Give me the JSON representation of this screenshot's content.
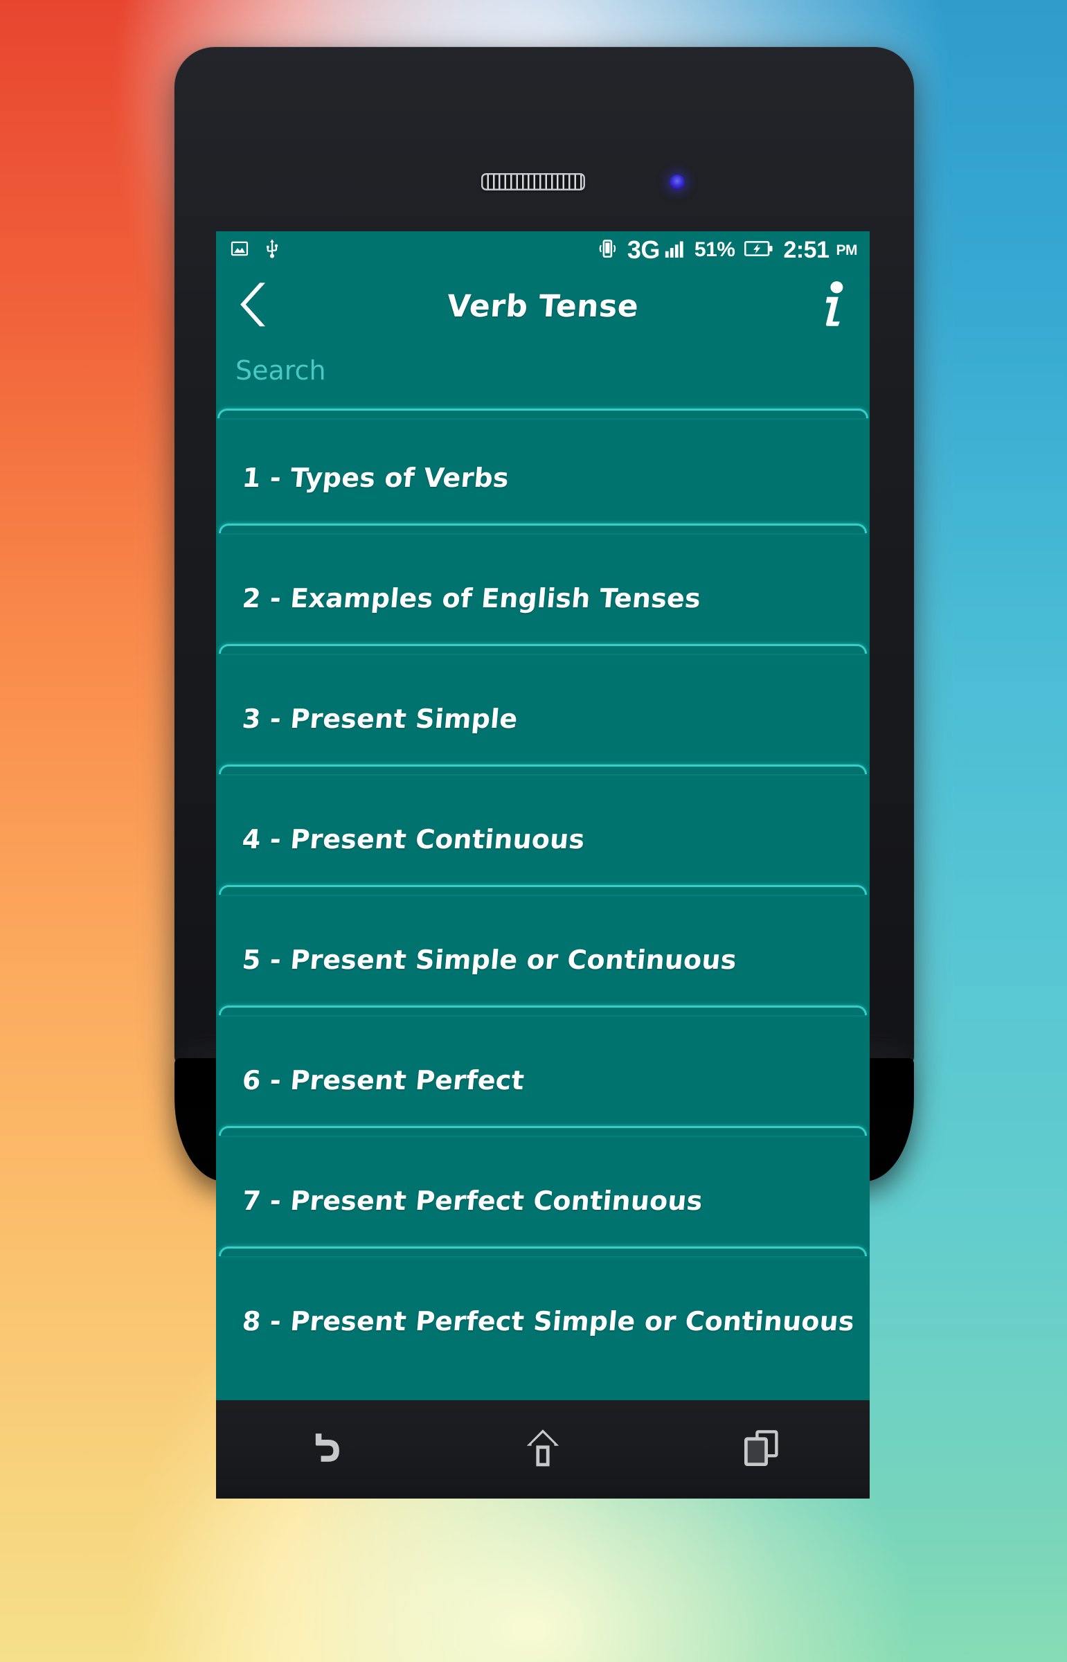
{
  "wallpaper": {
    "left_color": "#f0613a",
    "right_color": "#49bcd5",
    "top_glow": "#f0f0fa",
    "bottom_glow": "#fffacd"
  },
  "device": {
    "body_color": "#1b1d21",
    "speaker_name": "earpiece-speaker",
    "camera_name": "front-camera"
  },
  "statusbar": {
    "screenshot_icon": "image-icon",
    "usb_icon": "usb-icon",
    "vibrate_icon": "vibrate-icon",
    "network": "3G",
    "signal_icon": "signal-bars-icon",
    "battery_percent": "51%",
    "battery_icon": "battery-charging-icon",
    "time": "2:51",
    "ampm": "PM"
  },
  "appbar": {
    "back_icon": "back-chevron-icon",
    "title": "Verb Tense",
    "info_icon": "info-icon",
    "background": "#00736f"
  },
  "search": {
    "value": "",
    "placeholder": "Search",
    "placeholder_color": "#49c9c2",
    "underline_color": "#35cfc7"
  },
  "list": {
    "divider_color": "#35cfc7",
    "items": [
      {
        "label": "1 - Types of Verbs"
      },
      {
        "label": "2 - Examples of English Tenses"
      },
      {
        "label": "3 - Present Simple"
      },
      {
        "label": "4 - Present Continuous"
      },
      {
        "label": "5 - Present Simple or Continuous"
      },
      {
        "label": "6 - Present Perfect"
      },
      {
        "label": "7 - Present Perfect Continuous"
      },
      {
        "label": "8 - Present Perfect Simple or Continuous"
      }
    ]
  },
  "navbar": {
    "back_label": "Back",
    "home_label": "Home",
    "recents_label": "Recent apps"
  }
}
